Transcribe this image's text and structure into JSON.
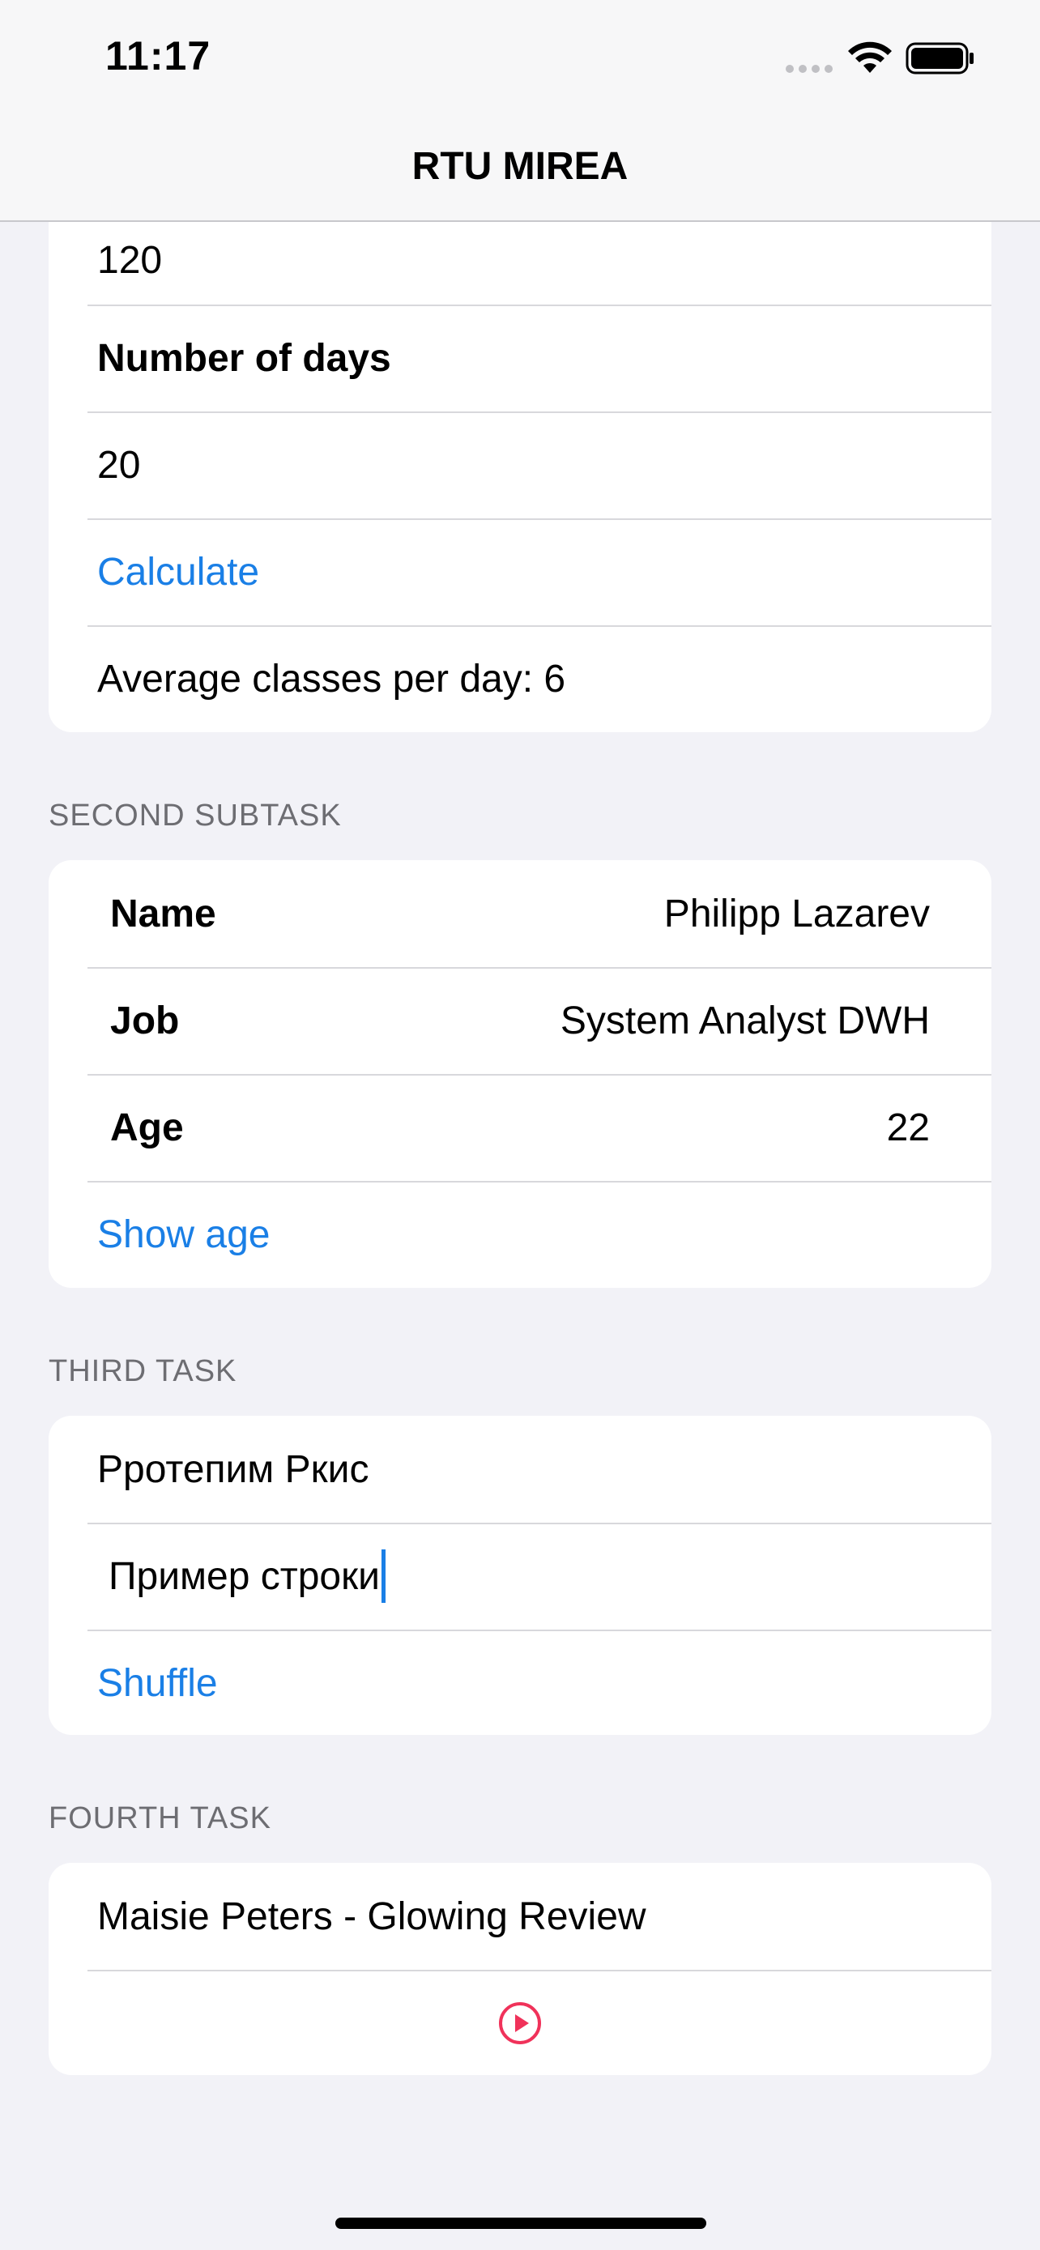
{
  "status_bar": {
    "time": "11:17"
  },
  "nav": {
    "title": "RTU MIREA"
  },
  "first_task": {
    "classes_value": "120",
    "days_label": "Number of days",
    "days_value": "20",
    "calculate_label": "Calculate",
    "result_text": "Average classes per day: 6"
  },
  "second_subtask": {
    "header": "SECOND SUBTASK",
    "rows": [
      {
        "label": "Name",
        "value": "Philipp Lazarev"
      },
      {
        "label": "Job",
        "value": "System Analyst DWH"
      },
      {
        "label": "Age",
        "value": "22"
      }
    ],
    "show_age_label": "Show age"
  },
  "third_task": {
    "header": "THIRD TASK",
    "shuffled_text": "Рротепим Ркис",
    "input_value": "Пример строки",
    "shuffle_label": "Shuffle"
  },
  "fourth_task": {
    "header": "FOURTH TASK",
    "track_title": "Maisie Peters - Glowing Review",
    "play_icon": "play-circle-icon",
    "play_color": "#f0325a"
  },
  "colors": {
    "accent": "#1a7fe6",
    "background": "#f2f2f7"
  }
}
